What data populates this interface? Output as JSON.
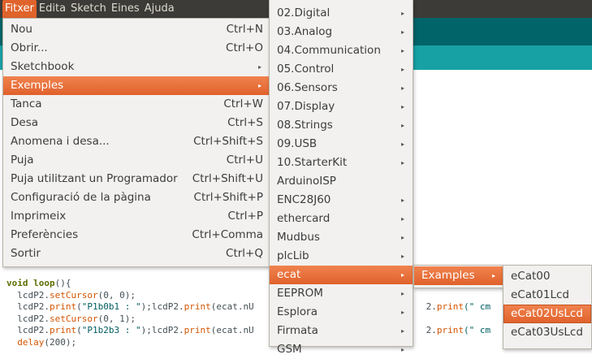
{
  "menubar": {
    "items": [
      "Fitxer",
      "Edita",
      "Sketch",
      "Eines",
      "Ajuda"
    ]
  },
  "file_menu": {
    "items": [
      {
        "label": "Nou",
        "shortcut": "Ctrl+N"
      },
      {
        "label": "Obrir...",
        "shortcut": "Ctrl+O"
      },
      {
        "label": "Sketchbook",
        "shortcut": "▸"
      },
      {
        "label": "Exemples",
        "shortcut": "▸"
      },
      {
        "label": "Tanca",
        "shortcut": "Ctrl+W"
      },
      {
        "label": "Desa",
        "shortcut": "Ctrl+S"
      },
      {
        "label": "Anomena i desa...",
        "shortcut": "Ctrl+Shift+S"
      },
      {
        "label": "Puja",
        "shortcut": "Ctrl+U"
      },
      {
        "label": "Puja utilitzant un Programador",
        "shortcut": "Ctrl+Shift+U"
      },
      {
        "label": "Configuració de la pàgina",
        "shortcut": "Ctrl+Shift+P"
      },
      {
        "label": "Imprimeix",
        "shortcut": "Ctrl+P"
      },
      {
        "label": "Preferències",
        "shortcut": "Ctrl+Comma"
      },
      {
        "label": "Sortir",
        "shortcut": "Ctrl+Q"
      }
    ]
  },
  "examples_menu": {
    "items": [
      {
        "label": "02.Digital",
        "sub": "▸"
      },
      {
        "label": "03.Analog",
        "sub": "▸"
      },
      {
        "label": "04.Communication",
        "sub": "▸"
      },
      {
        "label": "05.Control",
        "sub": "▸"
      },
      {
        "label": "06.Sensors",
        "sub": "▸"
      },
      {
        "label": "07.Display",
        "sub": "▸"
      },
      {
        "label": "08.Strings",
        "sub": "▸"
      },
      {
        "label": "09.USB",
        "sub": "▸"
      },
      {
        "label": "10.StarterKit",
        "sub": "▸"
      },
      {
        "label": "ArduinoISP",
        "sub": ""
      },
      {
        "label": "ENC28J60",
        "sub": "▸"
      },
      {
        "label": "ethercard",
        "sub": "▸"
      },
      {
        "label": "Mudbus",
        "sub": "▸"
      },
      {
        "label": "plcLib",
        "sub": "▸"
      },
      {
        "label": "ecat",
        "sub": "▸"
      },
      {
        "label": "EEPROM",
        "sub": "▸"
      },
      {
        "label": "Esplora",
        "sub": "▸"
      },
      {
        "label": "Firmata",
        "sub": "▸"
      },
      {
        "label": "GSM",
        "sub": "▸"
      }
    ]
  },
  "ecat_menu": {
    "items": [
      {
        "label": "Examples",
        "sub": "▸"
      }
    ]
  },
  "ecat_examples_menu": {
    "items": [
      "eCat00",
      "eCat01Lcd",
      "eCat02UsLcd",
      "eCat03UsLcd"
    ]
  },
  "code": {
    "l1_kw1": "void",
    "l1_kw2": "loop",
    "l1_rest": "(){",
    "l2_obj": "  lcdP2.",
    "l2_fn": "setCursor",
    "l2_rest": "(0, 0);",
    "l3_obj": "  lcdP2.",
    "l3_fn": "print",
    "l3_p": "(",
    "l3_str": "\"P1b0b1 : \"",
    "l3_mid": ");lcdP2.",
    "l3_fn2": "print",
    "l3_rest": "(ecat.nU",
    "l3_tail_obj": "2.",
    "l3_tail_fn": "print",
    "l3_tail_str": "(\" cm   \"",
    "l4_obj": "  lcdP2.",
    "l4_fn": "setCursor",
    "l4_rest": "(0, 1);",
    "l5_obj": "  lcdP2.",
    "l5_fn": "print",
    "l5_p": "(",
    "l5_str": "\"P1b2b3 : \"",
    "l5_mid": ");lcdP2.",
    "l5_fn2": "print",
    "l5_rest": "(ecat.nU",
    "l5_tail_obj": "2.",
    "l5_tail_fn": "print",
    "l5_tail_str": "(\" cm   \"",
    "l6_fn": "  delay",
    "l6_rest": "(200);"
  },
  "colors": {
    "menubar_bg": "#3c3b37",
    "highlight": "#e0612b",
    "ide_teal_dark": "#006468",
    "ide_teal_light": "#17a1a5"
  }
}
